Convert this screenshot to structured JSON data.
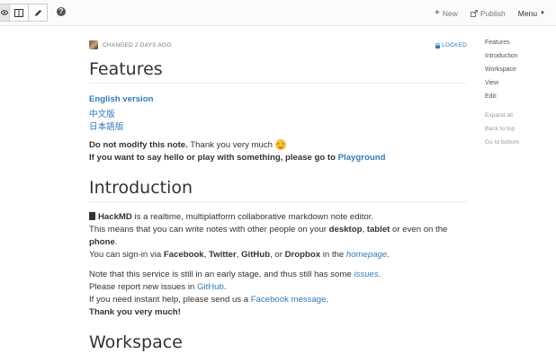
{
  "toolbar": {
    "buttons": [
      "view-mode",
      "both-mode",
      "edit-mode"
    ],
    "help_symbol": "?",
    "new_label": "New",
    "publish_label": "Publish",
    "menu_label": "Menu"
  },
  "meta": {
    "changed": "CHANGED 2 DAYS AGO",
    "locked": "LOCKED"
  },
  "features": {
    "heading": "Features",
    "links": [
      "English version",
      "中文版",
      "日本語版"
    ],
    "notice_bold": "Do not modify this note.",
    "notice_rest": " Thank you very much ",
    "hello_bold": "If you want to say hello or play with something, please go to ",
    "playground": "Playground"
  },
  "intro": {
    "heading": "Introduction",
    "name": "HackMD",
    "desc": " is a realtime, multiplatform collaborative markdown note editor.",
    "l2a": "This means that you can write notes with other people on your ",
    "desktop": "desktop",
    "comma": ", ",
    "tablet": "tablet",
    "or": " or even on the",
    "phone": "phone",
    "dot": ".",
    "l4a": "You can sign-in via ",
    "facebook": "Facebook",
    "twitter": "Twitter",
    "github": "GitHub",
    "or2": ", or ",
    "dropbox": "Dropbox",
    "inthe": " in the ",
    "homepage": "homepage",
    "early": "Note that this service is still in an early stage, and thus still has some ",
    "issues": "issues",
    "report": "Please report new issues in ",
    "github_link": "GitHub",
    "help": "If you need instant help, please send us a ",
    "fb_message": "Facebook message",
    "thanks": "Thank you very much!"
  },
  "workspace": {
    "heading": "Workspace"
  },
  "toc": {
    "items": [
      "Features",
      "Introduction",
      "Workspace",
      "View",
      "Edit:"
    ],
    "actions": [
      "Expand all",
      "Back to top",
      "Go to bottom"
    ]
  },
  "colors": {
    "link": "#337ab7",
    "text": "#333333",
    "muted": "#777777"
  }
}
